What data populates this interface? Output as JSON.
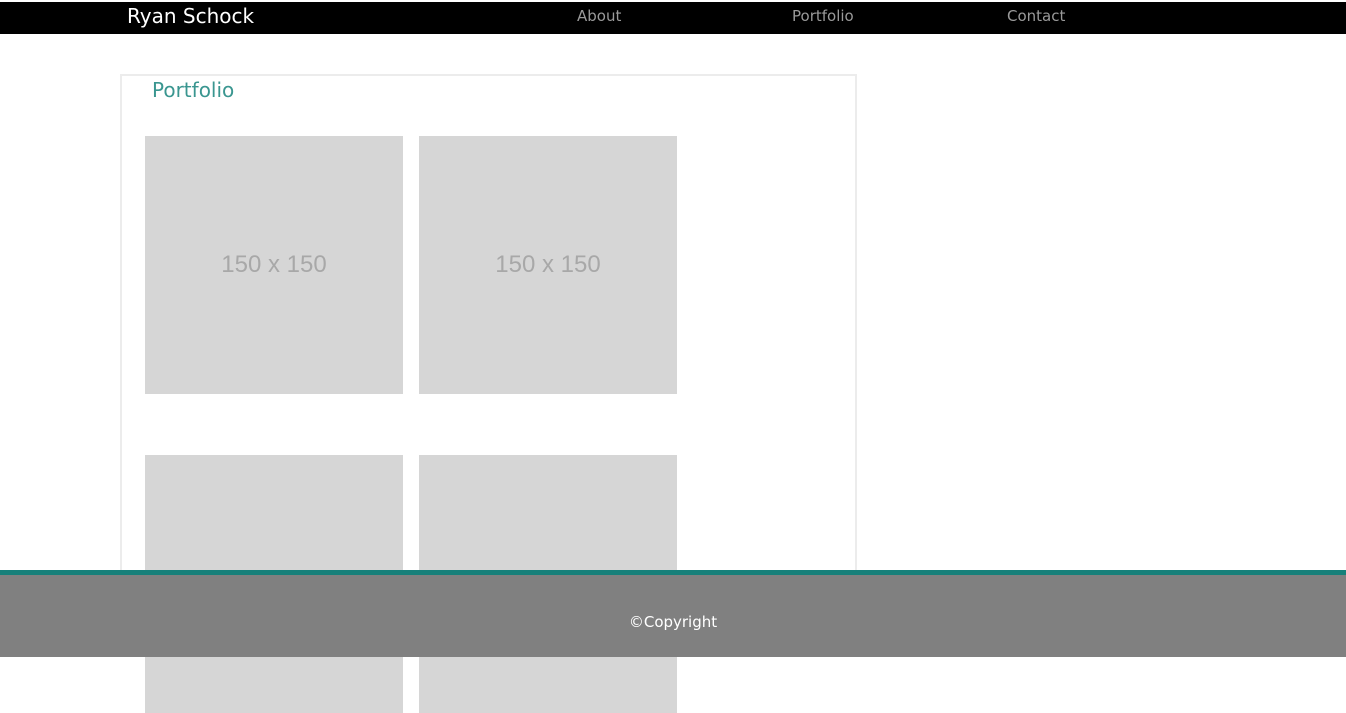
{
  "navbar": {
    "brand": "Ryan Schock",
    "links": [
      "About",
      "Portfolio",
      "Contact"
    ]
  },
  "main": {
    "title": "Portfolio",
    "thumbnails": [
      {
        "label": "150 x 150"
      },
      {
        "label": "150 x 150"
      },
      {
        "label": ""
      },
      {
        "label": ""
      }
    ]
  },
  "footer": {
    "copyright": "©Copyright"
  },
  "colors": {
    "accent": "#3a9690",
    "footer_border": "#17807a",
    "footer_bg": "#808080",
    "navbar_bg": "#000000",
    "placeholder_bg": "#d6d6d6"
  }
}
